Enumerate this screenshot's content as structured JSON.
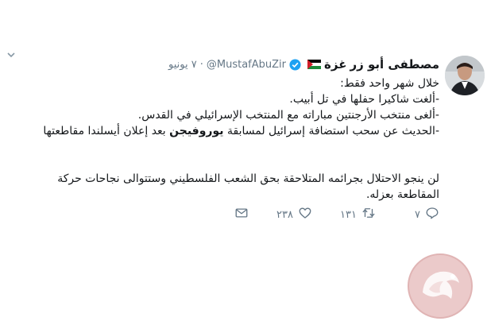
{
  "tweet": {
    "display_name": "مصطفى أبو زر",
    "location_label": "غزة",
    "handle": "@MustafAbuZir",
    "separator": "·",
    "date": "٧ يونيو",
    "lines": [
      "خلال شهر واحد فقط:",
      "-ألغت شاكيرا حفلها في تل أبيب.",
      "-ألغى منتخب الأرجنتين مباراته مع المنتخب الإسرائيلي في القدس.",
      "",
      "",
      "لن ينجو الاحتلال بجرائمه المتلاحقة بحق الشعب الفلسطيني وستتوالى نجاحات حركة",
      "المقاطعة بعزله."
    ],
    "line4_part1": "-الحديث عن سحب استضافة إسرائيل لمسابقة ",
    "line4_bold": "يوروفيجن",
    "line4_part2": " بعد إعلان أيسلندا مقاطعتها"
  },
  "actions": {
    "reply_count": "٧",
    "retweet_count": "١٣١",
    "like_count": "٢٣٨"
  },
  "icons": {
    "caret": "chevron-down-icon",
    "verified": "verified-badge-icon",
    "flag": "palestine-flag-icon",
    "reply": "reply-icon",
    "retweet": "retweet-icon",
    "like": "heart-icon",
    "dm": "envelope-icon",
    "watermark": "maan-logo-icon"
  },
  "colors": {
    "text": "#14171a",
    "muted": "#657786",
    "verified": "#1da1f2",
    "watermark": "#e8c8c8"
  }
}
